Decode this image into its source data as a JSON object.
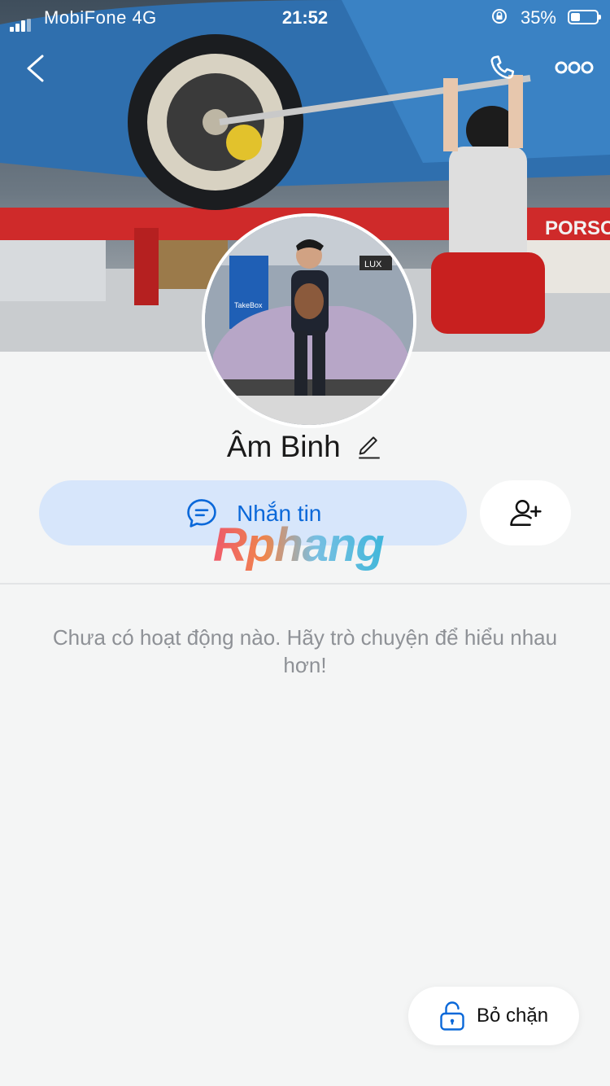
{
  "status_bar": {
    "carrier": "MobiFone  4G",
    "time": "21:52",
    "battery": "35%"
  },
  "profile": {
    "name": "Âm Binh"
  },
  "actions": {
    "message_label": "Nhắn tin"
  },
  "watermark": "Rphang",
  "cover": {
    "sign_text": "PORSCHE",
    "kiosk_text": "TakeBox",
    "lux_text": "LUX"
  },
  "empty_state": "Chưa có hoạt động nào. Hãy trò chuyện để hiểu nhau hơn!",
  "unblock": {
    "label": "Bỏ chặn"
  },
  "colors": {
    "accent": "#0a68d9",
    "message_bg": "#d7e6fb",
    "page_bg": "#f4f5f5"
  },
  "icons": {
    "back": "chevron-left-icon",
    "call": "phone-icon",
    "more": "more-icon",
    "edit": "pencil-icon",
    "message": "chat-bubble-icon",
    "add_friend": "add-user-icon",
    "unblock": "unlock-icon"
  }
}
